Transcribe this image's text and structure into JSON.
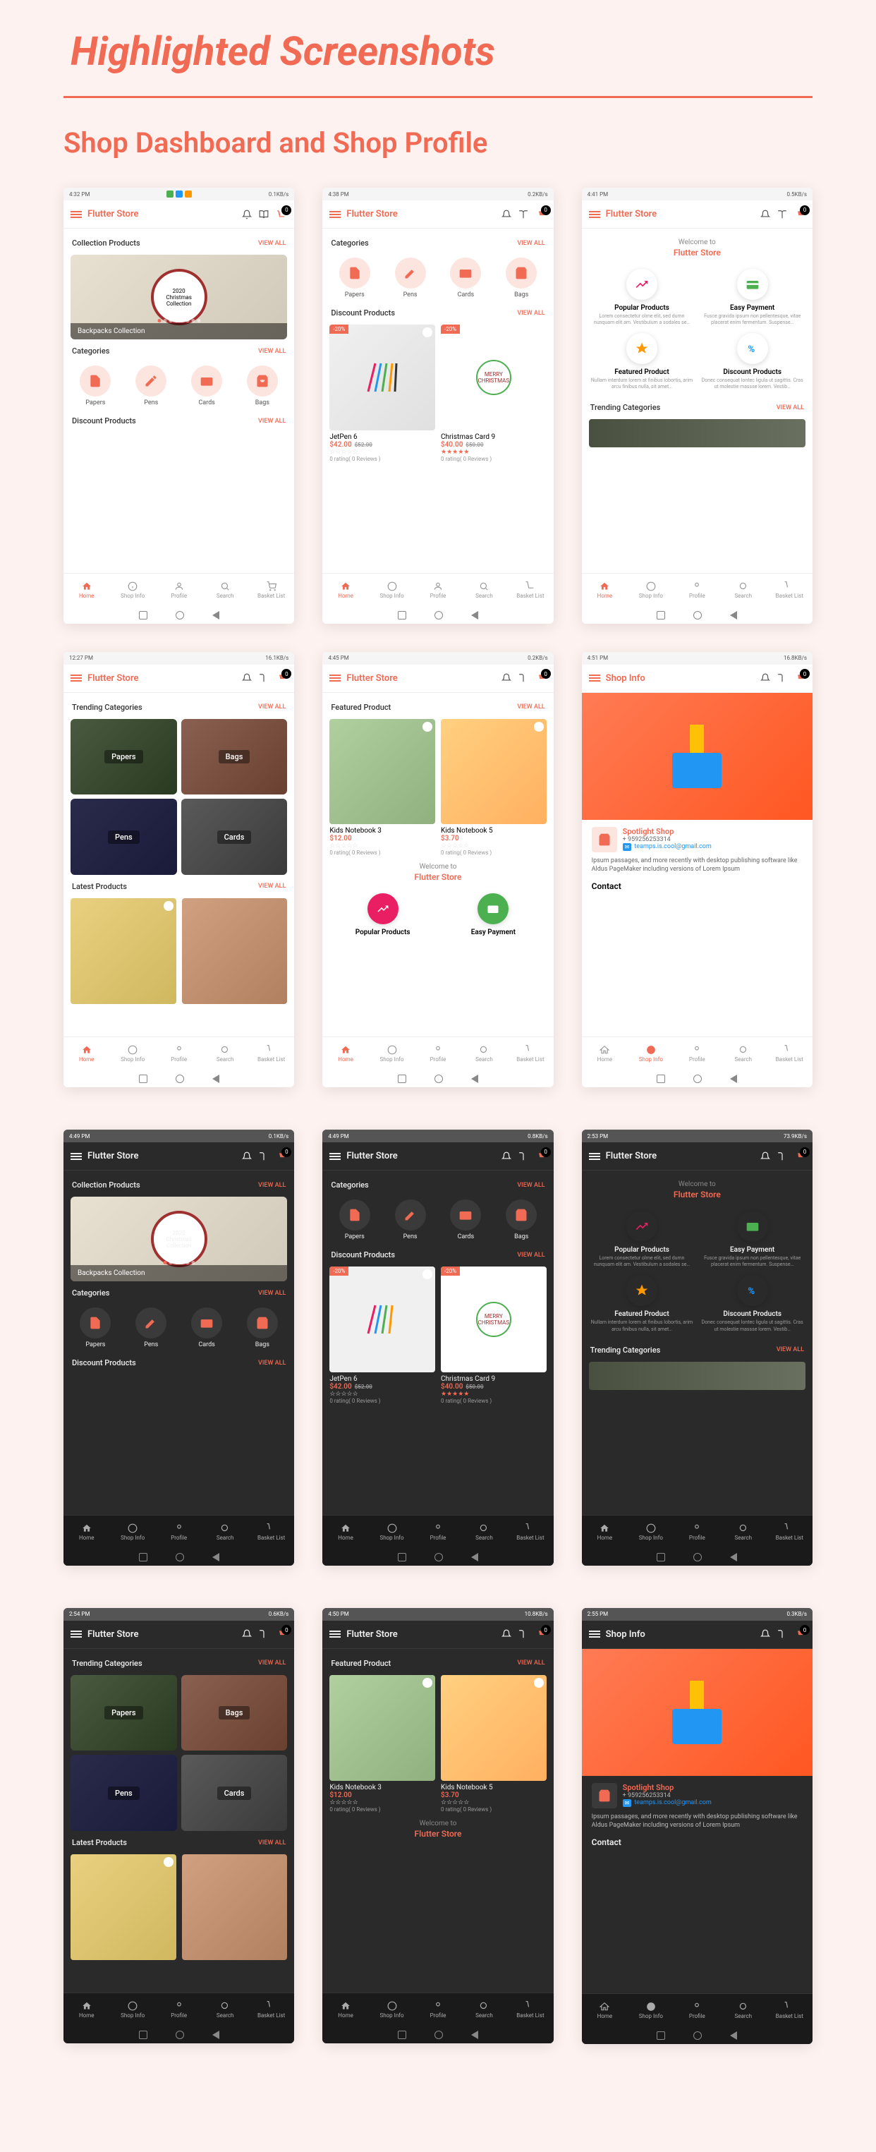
{
  "page_title": "Highlighted Screenshots",
  "section_title": "Shop Dashboard and Shop Profile",
  "app_name": "Flutter Store",
  "shop_info_title": "Shop Info",
  "cart_count": "0",
  "view_all": "VIEW ALL",
  "welcome": "Welcome to",
  "sections": {
    "collection": "Collection Products",
    "categories": "Categories",
    "discount": "Discount Products",
    "trending": "Trending Categories",
    "latest": "Latest Products",
    "featured": "Featured Product"
  },
  "hero": {
    "year": "2020",
    "line1": "Christmas",
    "line2": "Collection",
    "overlay": "Backpacks Collection"
  },
  "categories": [
    "Papers",
    "Pens",
    "Cards",
    "Bags"
  ],
  "nav": [
    "Home",
    "Shop Info",
    "Profile",
    "Search",
    "Basket List"
  ],
  "info_cards": [
    {
      "title": "Popular Products",
      "desc": "Lorem consectetur olme elit, sed dumn nunquam elit am. Vestibulum a sodales se…",
      "color": "#e91e63"
    },
    {
      "title": "Easy Payment",
      "desc": "Fusce gravida ipsum non pellentesque, vitae placerat enim fermentum. Suspense…",
      "color": "#4caf50"
    },
    {
      "title": "Featured Product",
      "desc": "Nullam interdum lorem at finibus lobortis, arim arcu finibus nulla, sit amet…",
      "color": "#ff9800"
    },
    {
      "title": "Discount Products",
      "desc": "Donec consequat lontec ligula ut sagittis. Cras ut molestie massse lorem. Vestib…",
      "color": "#2196f3"
    }
  ],
  "products": {
    "jetpen": {
      "name": "JetPen 6",
      "price": "$42.00",
      "old": "$52.00",
      "sale": "-20%",
      "rating": "0 rating( 0 Reviews )"
    },
    "card": {
      "name": "Christmas Card 9",
      "price": "$40.00",
      "old": "$50.00",
      "sale": "-20%",
      "rating": "0 rating( 0 Reviews )"
    },
    "nb3": {
      "name": "Kids Notebook 3",
      "price": "$12.00",
      "rating": "0 rating( 0 Reviews )"
    },
    "nb5": {
      "name": "Kids Notebook 5",
      "price": "$3.70",
      "rating": "0 rating( 0 Reviews )"
    }
  },
  "shop": {
    "name": "Spotlight Shop",
    "phone": "+ 959256253314",
    "email": "teamps.is.cool@gmail.com",
    "desc": "Ipsum passages, and more recently with desktop publishing software like Aldus PageMaker including versions of Lorem Ipsum",
    "contact": "Contact"
  },
  "status": {
    "times": [
      "4:32 PM",
      "4:38 PM",
      "4:41 PM",
      "12:27 PM",
      "4:45 PM",
      "4:51 PM",
      "4:49 PM",
      "4:49 PM",
      "2:53 PM",
      "2:54 PM",
      "4:50 PM",
      "2:55 PM"
    ],
    "speeds": [
      "0.1KB/s",
      "0.2KB/s",
      "0.5KB/s",
      "16.1KB/s",
      "0.2KB/s",
      "16.8KB/s",
      "0.1KB/s",
      "0.8KB/s",
      "73.9KB/s",
      "0.6KB/s",
      "10.8KB/s",
      "0.3KB/s"
    ]
  }
}
